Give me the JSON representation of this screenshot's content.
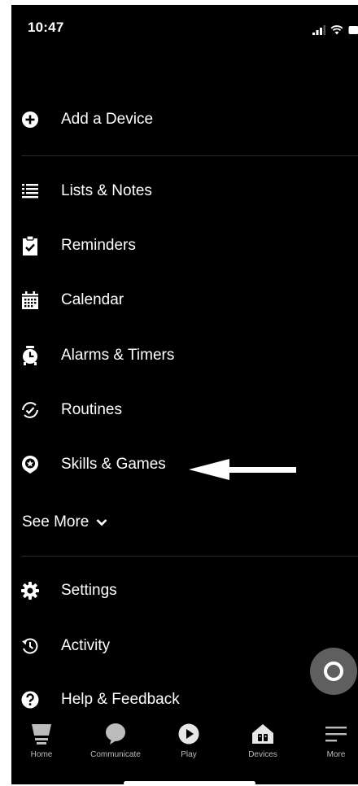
{
  "status_bar": {
    "time": "10:47"
  },
  "menu": {
    "add_device": "Add a Device",
    "items": [
      {
        "label": "Lists & Notes",
        "icon": "list-icon"
      },
      {
        "label": "Reminders",
        "icon": "reminder-clipboard-icon"
      },
      {
        "label": "Calendar",
        "icon": "calendar-icon"
      },
      {
        "label": "Alarms & Timers",
        "icon": "alarm-clock-icon"
      },
      {
        "label": "Routines",
        "icon": "routines-icon"
      },
      {
        "label": "Skills & Games",
        "icon": "skills-icon"
      }
    ],
    "see_more": "See More",
    "secondary": [
      {
        "label": "Settings",
        "icon": "gear-icon"
      },
      {
        "label": "Activity",
        "icon": "history-icon"
      },
      {
        "label": "Help & Feedback",
        "icon": "help-icon"
      }
    ]
  },
  "tab_bar": {
    "tabs": [
      {
        "label": "Home",
        "icon": "home-icon"
      },
      {
        "label": "Communicate",
        "icon": "chat-bubble-icon"
      },
      {
        "label": "Play",
        "icon": "play-icon"
      },
      {
        "label": "Devices",
        "icon": "devices-icon"
      },
      {
        "label": "More",
        "icon": "menu-icon"
      }
    ]
  },
  "colors": {
    "background": "#000000",
    "text": "#ffffff",
    "tab_label": "#bcbcbc",
    "alexa_button": "#5f5f5f"
  }
}
